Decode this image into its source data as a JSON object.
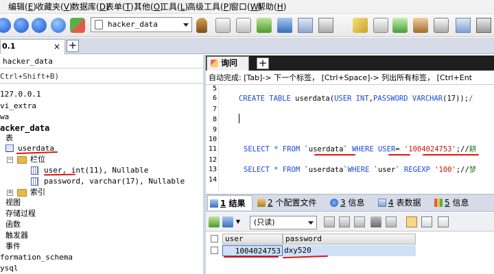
{
  "menu": [
    {
      "label": "编辑",
      "acc": "E"
    },
    {
      "label": "收藏夹",
      "acc": "V"
    },
    {
      "label": "数据库",
      "acc": "D"
    },
    {
      "label": "表单",
      "acc": "T"
    },
    {
      "label": "其他",
      "acc": "O"
    },
    {
      "label": "工具",
      "acc": "L"
    },
    {
      "label": "高级工具",
      "acc": "P"
    },
    {
      "label": "窗口",
      "acc": "W"
    },
    {
      "label": "帮助",
      "acc": "H"
    }
  ],
  "toolbar": {
    "database_select": "hacker_data"
  },
  "connection_tab": {
    "label": "0.1",
    "close": "×",
    "add": "+"
  },
  "left_panel": {
    "header": "hacker_data",
    "filter_hint": "Ctrl+Shift+B)",
    "tree": {
      "server": "127.0.0.1",
      "db1": "vi_extra",
      "db2": "wa",
      "current_db": "acker_data",
      "tables_folder": "表",
      "table": "userdata",
      "columns_folder": "栏位",
      "col1": "user, int(11), Nullable",
      "col2": "password, varchar(17), Nullable",
      "index_folder": "索引",
      "views": "视图",
      "procs": "存储过程",
      "funcs": "函数",
      "triggers": "触发器",
      "events": "事件",
      "db_info_schema": "formation_schema",
      "db_mysql": "ysql"
    }
  },
  "query_tab": {
    "label": "询问",
    "add": "+"
  },
  "autocomplete_hint": "自动完成:   [Tab]-> 下一个标签， [Ctrl+Space]-> 列出所有标签， [Ctrl+Ent",
  "editor": {
    "lines": [
      {
        "n": "5"
      },
      {
        "n": "6"
      },
      {
        "n": "7"
      },
      {
        "n": "8"
      },
      {
        "n": "9"
      },
      {
        "n": "10"
      },
      {
        "n": "11"
      },
      {
        "n": "12"
      },
      {
        "n": "13"
      },
      {
        "n": "14"
      }
    ],
    "line6": {
      "a": "CREATE TABLE",
      "b": " userdata(",
      "c": "USER INT",
      "d": ",",
      "e": "PASSWORD VARCHAR",
      "f": "(17));",
      "g": "/"
    },
    "line11": {
      "a": "SELECT * FROM",
      "b": " `userdata` ",
      "c": "WHERE",
      "d": " ",
      "e": "USER",
      "f": "= ",
      "g": "'1004024753'",
      "h": ";//",
      "i": "耕"
    },
    "line13": {
      "a": "SELECT * FROM",
      "b": " `userdata`",
      "c": "WHERE",
      "d": " `user` ",
      "e": "REGEXP",
      "f": " ",
      "g": "'100'",
      "h": ";//",
      "i": "梦"
    }
  },
  "result_tabs": [
    {
      "num": "1",
      "label": "结果"
    },
    {
      "num": "2",
      "label": "个配置文件"
    },
    {
      "num": "3",
      "label": "信息"
    },
    {
      "num": "4",
      "label": "表数据"
    },
    {
      "num": "5",
      "label": "信息"
    }
  ],
  "result_toolbar": {
    "mode": "(只读)"
  },
  "result_grid": {
    "columns": [
      "user",
      "password"
    ],
    "rows": [
      [
        "1004024753",
        "dxy520"
      ]
    ]
  },
  "colors": {
    "accent_blue": "#1a4bd6",
    "string_red": "#c4150c",
    "comment_green": "#1c7a1c",
    "annotation_red": "#e01010",
    "selected_row": "#cfe0f7"
  }
}
